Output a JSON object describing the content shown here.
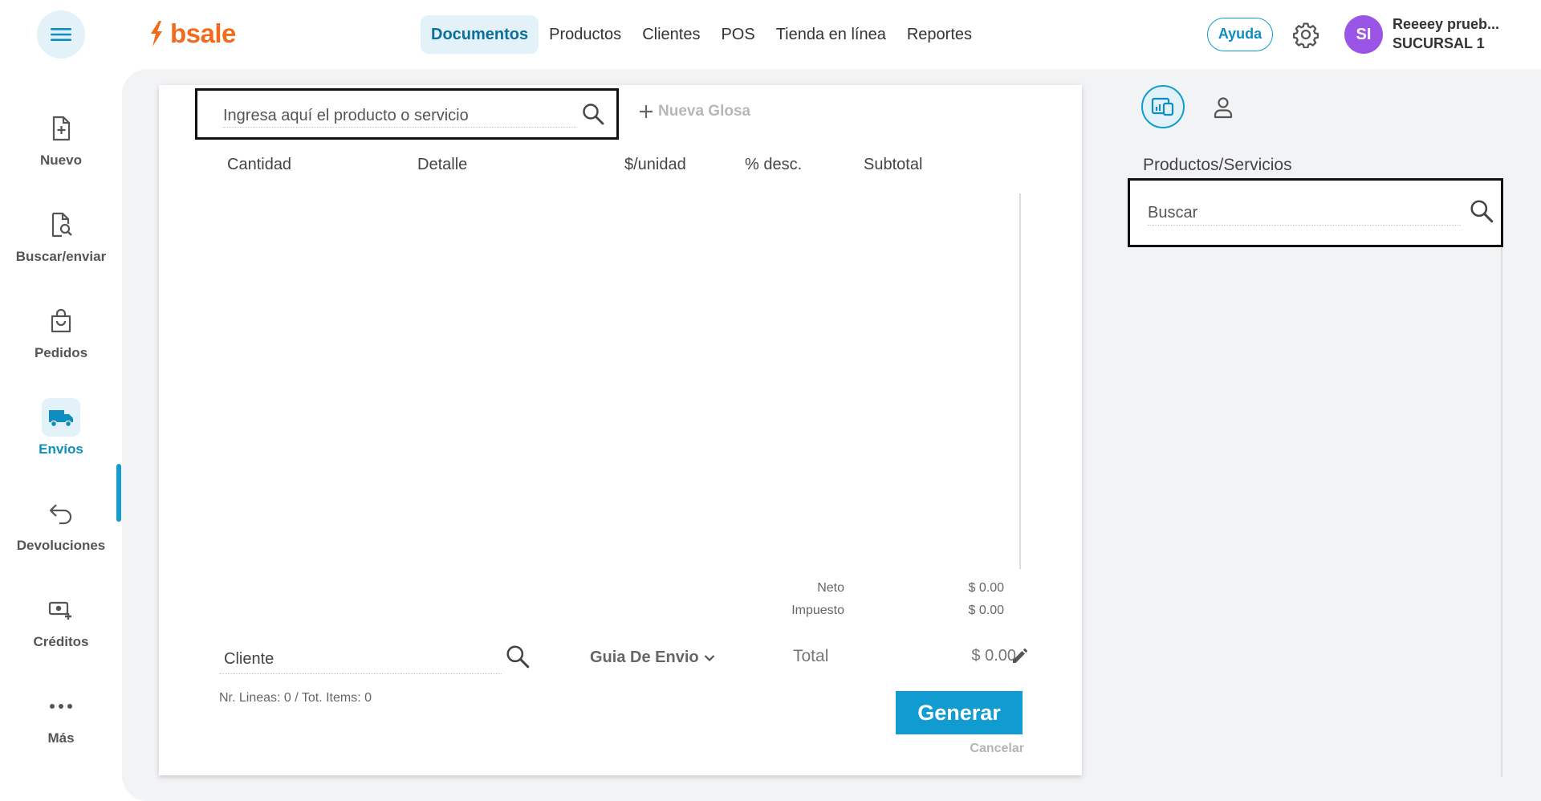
{
  "brand": {
    "name": "bsale",
    "color": "#f26b1d"
  },
  "colors": {
    "accent": "#0e9ed0",
    "active_bg": "#e3f1f8",
    "avatar": "#9b55e6"
  },
  "topnav": {
    "items": [
      {
        "label": "Documentos",
        "active": true
      },
      {
        "label": "Productos"
      },
      {
        "label": "Clientes"
      },
      {
        "label": "POS"
      },
      {
        "label": "Tienda en línea"
      },
      {
        "label": "Reportes"
      }
    ],
    "help_label": "Ayuda",
    "settings_icon": "gear-icon",
    "user": {
      "initials": "SI",
      "name": "Reeeey prueb...",
      "branch": "SUCURSAL 1"
    }
  },
  "sidebar": {
    "items": [
      {
        "label": "Nuevo",
        "icon": "new-document-icon"
      },
      {
        "label": "Buscar/enviar",
        "icon": "search-document-icon"
      },
      {
        "label": "Pedidos",
        "icon": "shopping-bag-icon"
      },
      {
        "label": "Envíos",
        "icon": "truck-icon",
        "active": true
      },
      {
        "label": "Devoluciones",
        "icon": "return-arrow-icon"
      },
      {
        "label": "Créditos",
        "icon": "cash-plus-icon"
      },
      {
        "label": "Más",
        "icon": "more-dots-icon"
      }
    ]
  },
  "document": {
    "search_placeholder": "Ingresa aquí el producto o servicio",
    "new_glosa_label": "Nueva Glosa",
    "columns": [
      "Cantidad",
      "Detalle",
      "$/unidad",
      "% desc.",
      "Subtotal"
    ],
    "summary": {
      "neto_label": "Neto",
      "neto_value": "$ 0.00",
      "impuesto_label": "Impuesto",
      "impuesto_value": "$ 0.00",
      "total_label": "Total",
      "total_value": "$ 0.00"
    },
    "client_label": "Cliente",
    "doc_type": "Guia De Envio",
    "line_count": "Nr. Lineas: 0 / Tot. Items: 0",
    "generate_label": "Generar",
    "cancel_label": "Cancelar"
  },
  "right_panel": {
    "title": "Productos/Servicios",
    "search_placeholder": "Buscar"
  }
}
